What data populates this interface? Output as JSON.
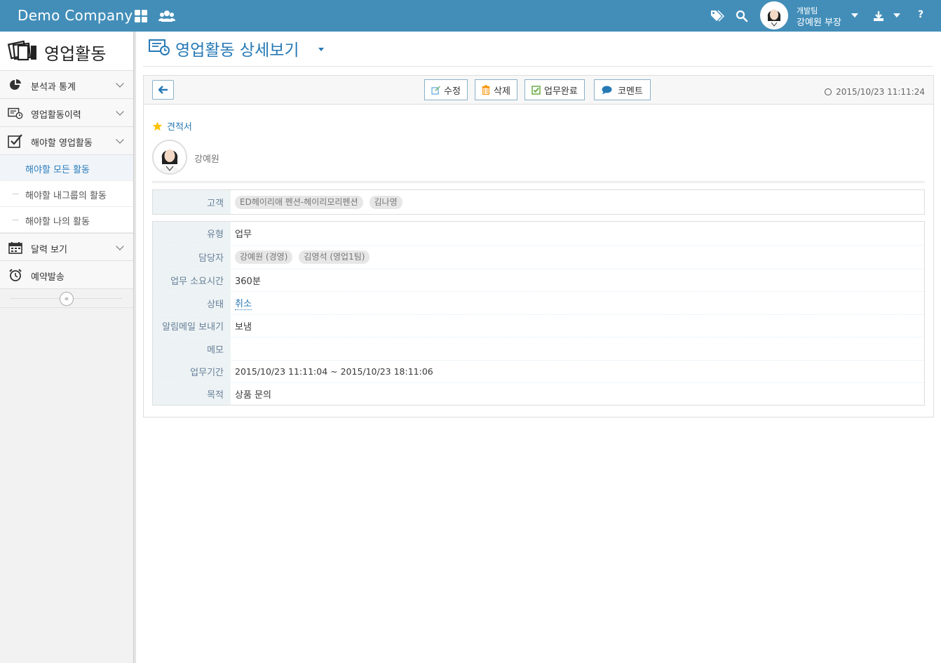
{
  "topbar": {
    "brand": "Demo Company",
    "icons": [
      "grid-icon",
      "users-icon",
      "tags-icon",
      "search-icon",
      "download-icon"
    ],
    "user_team": "개발팀",
    "user_name": "강예원 부장",
    "help": "?"
  },
  "sidebar": {
    "title": "영업활동",
    "items": [
      {
        "label": "분석과 통계",
        "icon": "pie-chart-icon"
      },
      {
        "label": "영업활동이력",
        "icon": "history-icon"
      },
      {
        "label": "해야할 영업활동",
        "icon": "checkbox-icon"
      }
    ],
    "sub_items": [
      {
        "label": "해야할 모든 활동",
        "active": true
      },
      {
        "label": "해야할 내그룹의 활동",
        "active": false
      },
      {
        "label": "해야할 나의 활동",
        "active": false
      }
    ],
    "items_after": [
      {
        "label": "달력 보기",
        "icon": "calendar-icon"
      },
      {
        "label": "예약발송",
        "icon": "alarm-icon"
      }
    ],
    "collapse_glyph": "«"
  },
  "page": {
    "title": "영업활동 상세보기"
  },
  "toolbar": {
    "edit_label": "수정",
    "delete_label": "삭제",
    "complete_label": "업무완료",
    "comment_label": "코멘트",
    "timestamp": "2015/10/23 11:11:24"
  },
  "detail": {
    "tag": "견적서",
    "author": "강예원",
    "customer_label": "고객",
    "customers": [
      "ED헤이리애 펜션-헤이리모리펜션",
      "김나영"
    ],
    "fields": {
      "type_label": "유형",
      "type_value": "업무",
      "assignee_label": "담당자",
      "assignees": [
        "강예원 (경영)",
        "김영석 (영업1팀)"
      ],
      "duration_label": "업무 소요시간",
      "duration_value": "360분",
      "status_label": "상태",
      "status_value": "취소",
      "notify_label": "알림메일 보내기",
      "notify_value": "보냄",
      "memo_label": "메모",
      "memo_value": "",
      "period_label": "업무기간",
      "period_value": "2015/10/23 11:11:04 ~ 2015/10/23 18:11:06",
      "purpose_label": "목적",
      "purpose_value": "상품 문의"
    }
  },
  "colors": {
    "topbar": "#438eb9",
    "title": "#2679b5",
    "label_bg": "#edf3f4",
    "label_text": "#667e99"
  }
}
